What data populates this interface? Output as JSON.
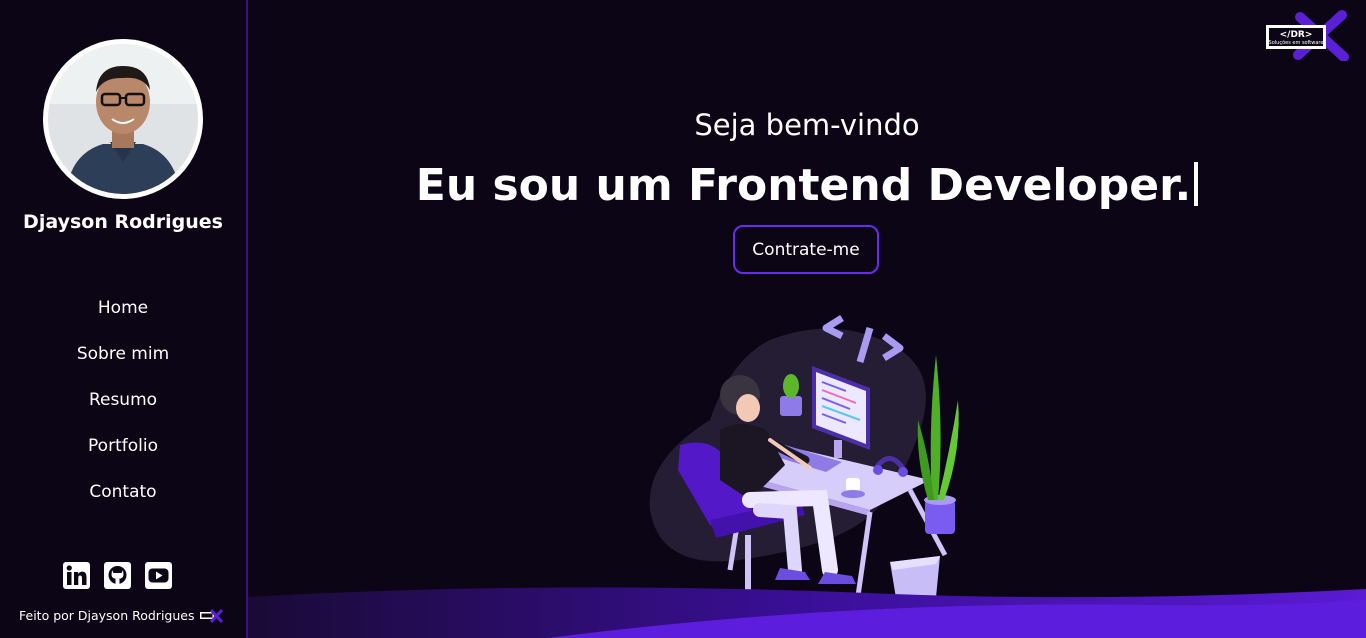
{
  "profile": {
    "name": "Djayson Rodrigues"
  },
  "nav": {
    "items": [
      {
        "label": "Home"
      },
      {
        "label": "Sobre mim"
      },
      {
        "label": "Resumo"
      },
      {
        "label": "Portfolio"
      },
      {
        "label": "Contato"
      }
    ]
  },
  "socials": {
    "icons": [
      "linkedin-icon",
      "github-icon",
      "youtube-icon"
    ]
  },
  "footer": {
    "credit": "Feito por Djayson Rodrigues"
  },
  "brand": {
    "logo_text": "</DR>",
    "logo_subtext": "Soluções em software"
  },
  "hero": {
    "greeting": "Seja bem-vindo",
    "headline": "Eu sou um Frontend Developer.",
    "cta_label": "Contrate-me"
  },
  "colors": {
    "background": "#0b0516",
    "accent": "#6b2af0",
    "sidebar_border": "#3a1380"
  }
}
